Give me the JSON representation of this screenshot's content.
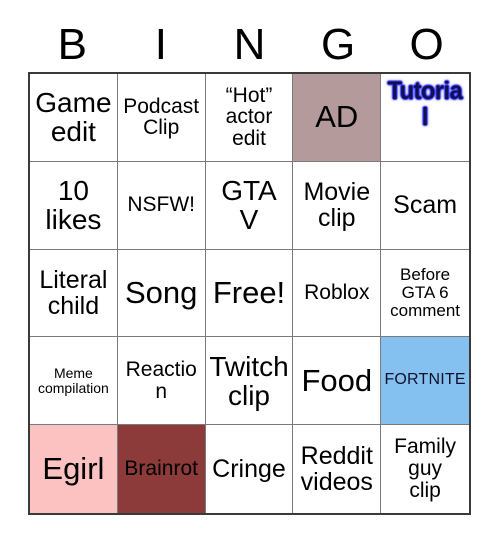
{
  "card": {
    "title_letters": [
      "B",
      "I",
      "N",
      "G",
      "O"
    ],
    "colors": {
      "grid_border": "#3a3a3a",
      "cell_border": "#7a7a7a",
      "cell_background": "#ffffff",
      "text": "#000000",
      "ad_cell_background": "#b49a9a",
      "fortnite_cell_background": "#85c1f0",
      "egirl_cell_background": "#fcc2c2",
      "brainrot_cell_background": "#8c3a3a",
      "tutorial_text": "#10104e",
      "tutorial_glow": "#3a3aff"
    },
    "rows": [
      [
        {
          "label": "Game\nedit",
          "size": "fs-lg",
          "bg": null
        },
        {
          "label": "Podcast\nClip",
          "size": "fs-sm",
          "bg": null
        },
        {
          "label": "“Hot”\nactor\nedit",
          "size": "fs-sm",
          "bg": null
        },
        {
          "label": "AD",
          "size": "fs-xl",
          "bg": "#b49a9a"
        },
        {
          "label": "Tutorial",
          "size": "fs-md",
          "bg": null,
          "style": "tutorial"
        }
      ],
      [
        {
          "label": "10\nlikes",
          "size": "fs-lg",
          "bg": null
        },
        {
          "label": "NSFW!",
          "size": "fs-sm",
          "bg": null
        },
        {
          "label": "GTA\nV",
          "size": "fs-lg",
          "bg": null
        },
        {
          "label": "Movie\nclip",
          "size": "fs-md",
          "bg": null
        },
        {
          "label": "Scam",
          "size": "fs-md",
          "bg": null
        }
      ],
      [
        {
          "label": "Literal\nchild",
          "size": "fs-md",
          "bg": null
        },
        {
          "label": "Song",
          "size": "fs-xl",
          "bg": null
        },
        {
          "label": "Free!",
          "size": "fs-xl",
          "bg": null
        },
        {
          "label": "Roblox",
          "size": "fs-sm",
          "bg": null
        },
        {
          "label": "Before\nGTA 6\ncomment",
          "size": "fs-xs",
          "bg": null
        }
      ],
      [
        {
          "label": "Meme\ncompilation",
          "size": "fs-xxs",
          "bg": null
        },
        {
          "label": "Reaction",
          "size": "fs-sm",
          "bg": null
        },
        {
          "label": "Twitch\nclip",
          "size": "fs-lg",
          "bg": null
        },
        {
          "label": "Food",
          "size": "fs-xl",
          "bg": null
        },
        {
          "label": "FORTNITE",
          "size": "fs-xs",
          "bg": "#85c1f0",
          "style": "fortnite"
        }
      ],
      [
        {
          "label": "Egirl",
          "size": "fs-xl",
          "bg": "#fcc2c2"
        },
        {
          "label": "Brainrot",
          "size": "fs-sm",
          "bg": "#8c3a3a"
        },
        {
          "label": "Cringe",
          "size": "fs-md",
          "bg": null
        },
        {
          "label": "Reddit\nvideos",
          "size": "fs-md",
          "bg": null
        },
        {
          "label": "Family\nguy\nclip",
          "size": "fs-sm",
          "bg": null
        }
      ]
    ]
  }
}
